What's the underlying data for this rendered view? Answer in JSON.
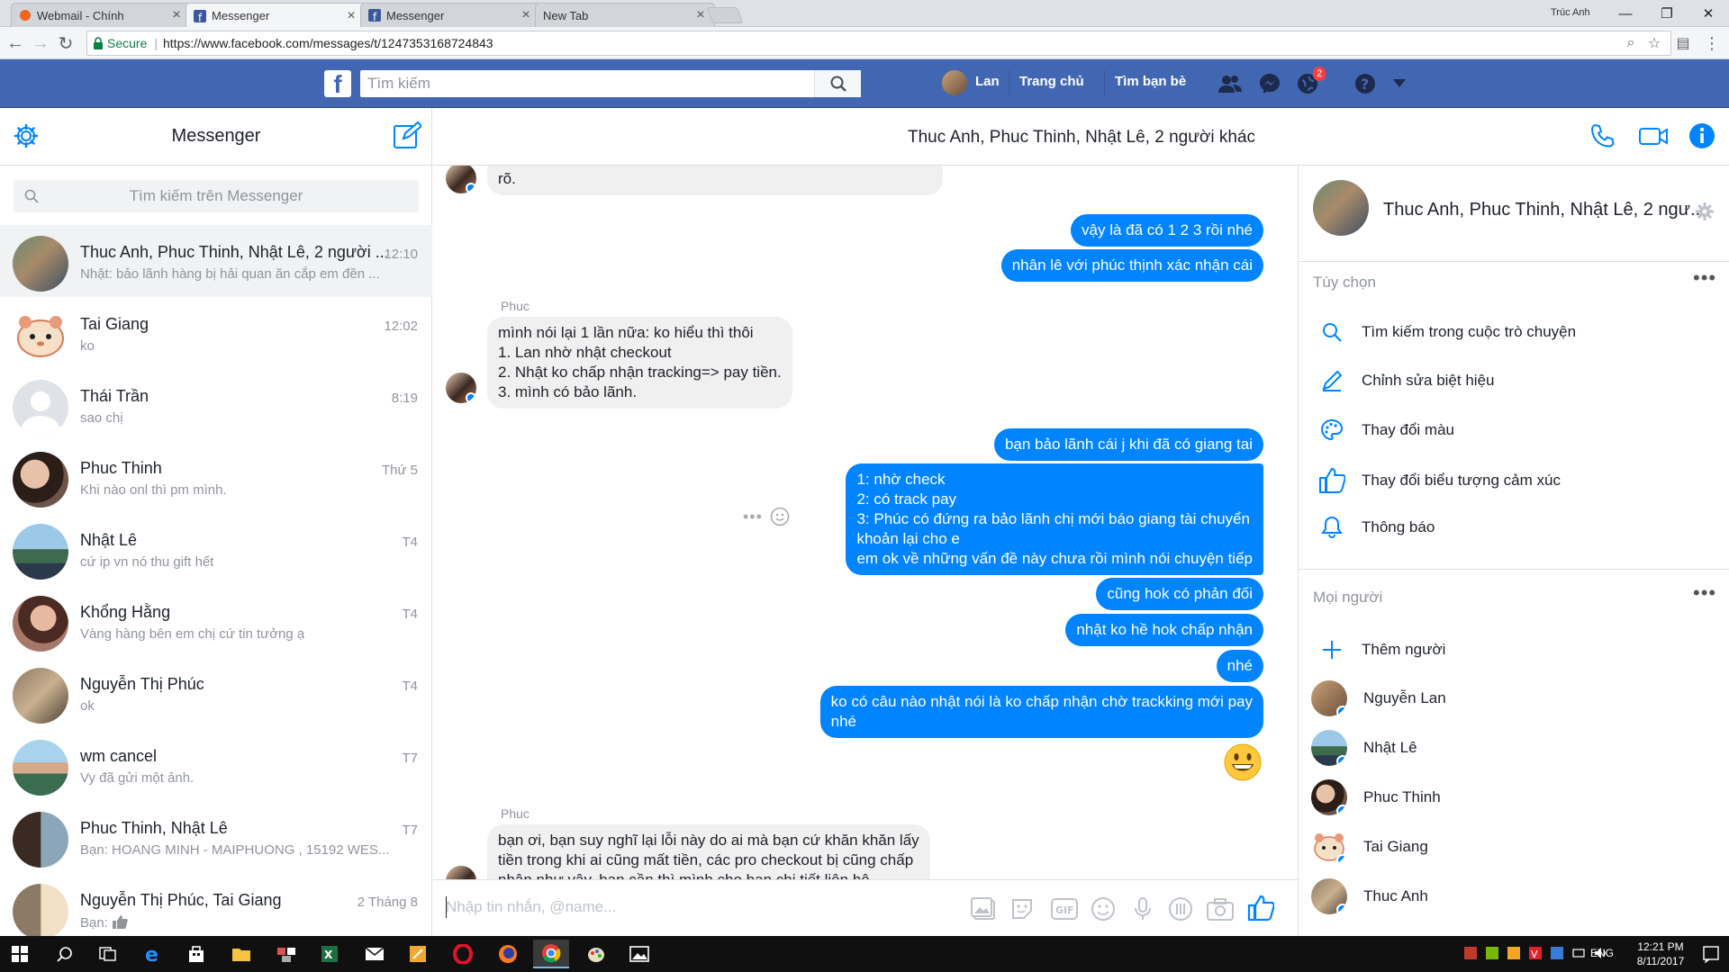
{
  "browser": {
    "tabs": [
      {
        "title": "Webmail - Chính"
      },
      {
        "title": "Messenger"
      },
      {
        "title": "Messenger"
      },
      {
        "title": "New Tab"
      }
    ],
    "profile": "Trúc Anh",
    "secure_label": "Secure",
    "url": "https://www.facebook.com/messages/t/1247353168724843"
  },
  "fb": {
    "search_placeholder": "Tìm kiếm",
    "user": "Lan",
    "home": "Trang chủ",
    "find_friends": "Tìm bạn bè",
    "notif_count": "2"
  },
  "sidebar": {
    "title": "Messenger",
    "search_placeholder": "Tìm kiếm trên Messenger",
    "conversations": [
      {
        "name": "Thuc Anh, Phuc Thinh, Nhật Lê, 2 người ...",
        "preview": "Nhật: bảo lãnh hàng bị hải quan ăn cắp em đền ...",
        "time": "12:10"
      },
      {
        "name": "Tai Giang",
        "preview": "ko",
        "time": "12:02"
      },
      {
        "name": "Thái Trần",
        "preview": "sao chị",
        "time": "8:19"
      },
      {
        "name": "Phuc Thinh",
        "preview": "Khi nào onl thì pm mình.",
        "time": "Thứ 5"
      },
      {
        "name": "Nhật Lê",
        "preview": "cứ ip vn nó thu gift hết",
        "time": "T4"
      },
      {
        "name": "Khổng Hằng",
        "preview": "Vàng hàng bên em chị cứ tin tưởng ạ",
        "time": "T4"
      },
      {
        "name": "Nguyễn Thị Phúc",
        "preview": "ok",
        "time": "T4"
      },
      {
        "name": "wm cancel",
        "preview": "Vy đã gửi một ảnh.",
        "time": "T7"
      },
      {
        "name": "Phuc Thinh, Nhật Lê",
        "preview": "Bạn: HOANG MINH - MAIPHUONG , 15192 WES...",
        "time": "T7"
      },
      {
        "name": "Nguyễn Thị Phúc, Tai Giang",
        "preview": "Bạn:",
        "time": "2 Tháng 8"
      }
    ]
  },
  "chat": {
    "title": "Thuc Anh, Phuc Thinh, Nhật Lê, 2 người khác",
    "m0": "rõ.",
    "m1": "vậy là đã có 1 2 3 rồi nhé",
    "m2": "nhân lê với phúc thịnh xác nhận cái",
    "sender1": "Phuc",
    "m3": [
      "mình nói lại 1 lần nữa: ko hiểu thì thôi",
      "1. Lan nhờ nhật checkout",
      "2. Nhật ko chấp nhận tracking=> pay tiền.",
      "3. mình có bảo lãnh."
    ],
    "m4": "bạn bảo lãnh cái j khi đã có giang tai",
    "m5": [
      "1: nhờ check",
      "2: có track pay",
      "3: Phúc có đứng ra bảo lãnh chị mới báo giang tài chuyển",
      "khoản lại cho e",
      "em ok về những vấn đề này chưa rồi mình nói chuyện tiếp"
    ],
    "m6": "cũng hok có phản đối",
    "m7": "nhật ko hề hok chấp nhận",
    "m8": "nhé",
    "m9": [
      "ko có câu nào nhật nói là ko chấp nhận chờ trackking mới pay",
      "nhé"
    ],
    "sender2": "Phuc",
    "m10": [
      "bạn ơi, bạn suy nghĩ lại lỗi này do ai mà bạn cứ khăn khăn lấy",
      "tiền trong khi ai cũng mất tiền, các pro checkout bị cũng chấp",
      "nhận như vậy, bạn cần thì mình cho bạn chi tiết liên hệ"
    ],
    "composer_placeholder": "Nhập tin nhắn, @name..."
  },
  "panel": {
    "title": "Thuc Anh, Phuc Thinh, Nhật Lê, 2 ngư...",
    "options_header": "Tùy chọn",
    "options": [
      "Tìm kiếm trong cuộc trò chuyện",
      "Chỉnh sửa biệt hiệu",
      "Thay đổi màu",
      "Thay đổi biểu tượng cảm xúc",
      "Thông báo"
    ],
    "people_header": "Mọi người",
    "add_person": "Thêm người",
    "people": [
      "Nguyễn Lan",
      "Nhật Lê",
      "Phuc Thinh",
      "Tai Giang",
      "Thuc Anh"
    ]
  },
  "taskbar": {
    "lang": "ENG",
    "time": "12:21 PM",
    "date": "8/11/2017"
  },
  "colors": {
    "fb_blue": "#4267b2",
    "messenger_blue": "#0084ff"
  }
}
